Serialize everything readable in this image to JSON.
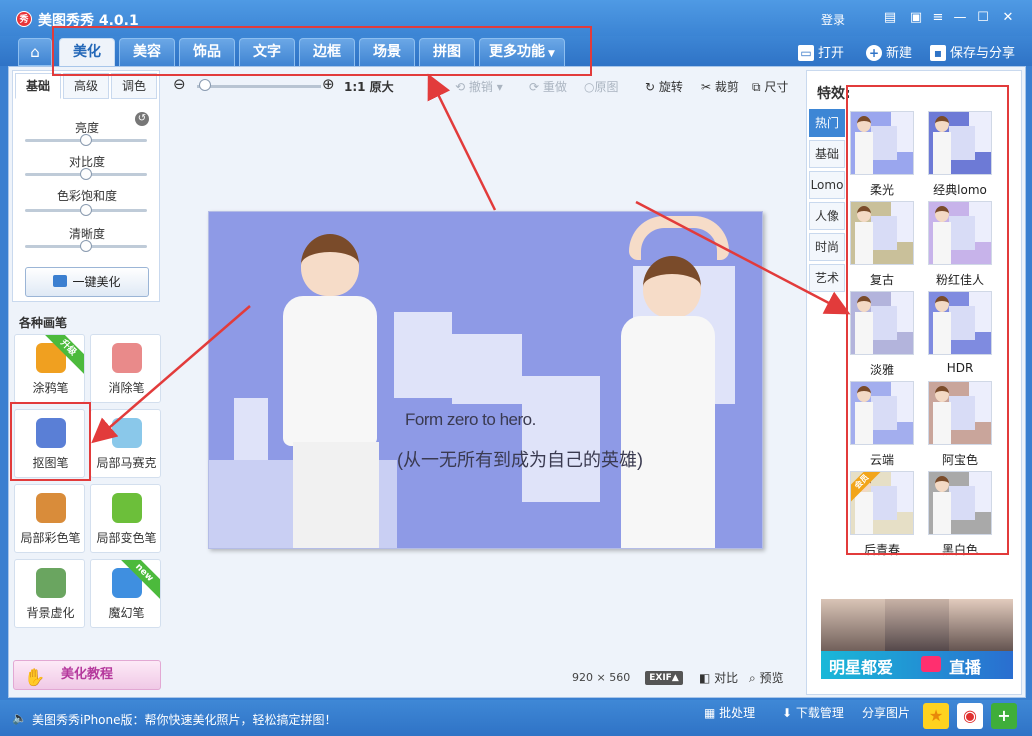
{
  "app": {
    "title": "美图秀秀 4.0.1",
    "logo_text": "秀",
    "login": "登录"
  },
  "title_icons": [
    "chat-icon",
    "feedback-icon",
    "menu-icon",
    "minimize-icon",
    "maximize-icon",
    "close-icon"
  ],
  "tabs": [
    {
      "label": "美化",
      "active": true
    },
    {
      "label": "美容"
    },
    {
      "label": "饰品"
    },
    {
      "label": "文字"
    },
    {
      "label": "边框"
    },
    {
      "label": "场景"
    },
    {
      "label": "拼图"
    },
    {
      "label": "更多功能"
    }
  ],
  "toolbar_actions": {
    "open": "打开",
    "new": "新建",
    "save": "保存与分享"
  },
  "left": {
    "subtabs": [
      "基础",
      "高级",
      "调色"
    ],
    "sliders": [
      {
        "label": "亮度",
        "value": 0.5
      },
      {
        "label": "对比度",
        "value": 0.5
      },
      {
        "label": "色彩饱和度",
        "value": 0.5
      },
      {
        "label": "清晰度",
        "value": 0.5
      }
    ],
    "onekey": "一键美化",
    "brush_heading": "各种画笔",
    "brushes": [
      {
        "label": "涂鸦笔",
        "badge": "升级",
        "color": "#f0a020"
      },
      {
        "label": "消除笔",
        "badge": "",
        "color": "#e98a8a"
      },
      {
        "label": "抠图笔",
        "badge": "",
        "color": "#5a7fd6"
      },
      {
        "label": "局部马赛克",
        "badge": "",
        "color": "#8ac8ea"
      },
      {
        "label": "局部彩色笔",
        "badge": "",
        "color": "#d98c3a"
      },
      {
        "label": "局部变色笔",
        "badge": "",
        "color": "#6cbf3a"
      },
      {
        "label": "背景虚化",
        "badge": "",
        "color": "#6aa560"
      },
      {
        "label": "魔幻笔",
        "badge": "new",
        "color": "#3f8fe0"
      }
    ],
    "tutorial": "美化教程"
  },
  "editbar": {
    "zoom_level": 0,
    "original_size": "1:1 原大",
    "undo": "撤销",
    "redo": "重做",
    "original": "原图",
    "rotate": "旋转",
    "crop": "裁剪",
    "size": "尺寸"
  },
  "photo": {
    "text1": "Form zero to hero.",
    "text2": "(从一无所有到成为自己的英雄)",
    "width": "920",
    "times": "×",
    "height": "560",
    "exif": "EXIF▲",
    "compare": "对比",
    "preview": "预览"
  },
  "effects": {
    "title": "特效:",
    "categories": [
      {
        "label": "热门",
        "active": true
      },
      {
        "label": "基础"
      },
      {
        "label": "Lomo"
      },
      {
        "label": "人像"
      },
      {
        "label": "时尚"
      },
      {
        "label": "艺术"
      }
    ],
    "items": [
      {
        "label": "柔光",
        "tint": "#9aa6ee",
        "badge": ""
      },
      {
        "label": "经典lomo",
        "tint": "#6d7ad6",
        "badge": ""
      },
      {
        "label": "复古",
        "tint": "#c9c09a",
        "badge": ""
      },
      {
        "label": "粉红佳人",
        "tint": "#c7b3ea",
        "badge": ""
      },
      {
        "label": "淡雅",
        "tint": "#b3b4dc",
        "badge": ""
      },
      {
        "label": "HDR",
        "tint": "#7f8be0",
        "badge": ""
      },
      {
        "label": "云端",
        "tint": "#a3aeee",
        "badge": ""
      },
      {
        "label": "阿宝色",
        "tint": "#c9a59b",
        "badge": ""
      },
      {
        "label": "后青春",
        "tint": "#e6dfc6",
        "badge": "会员"
      },
      {
        "label": "黑白色",
        "tint": "#a9a9a9",
        "badge": ""
      }
    ],
    "promo_text1": "明星都爱",
    "promo_text2": "直播"
  },
  "statusbar": {
    "message": "美图秀秀iPhone版：帮你快速美化照片，轻松搞定拼图！",
    "batch": "批处理",
    "download": "下载管理",
    "share": "分享图片"
  },
  "colors": {
    "accent": "#3d86d5",
    "highlight": "#e23b3b",
    "canvas": "#8e9ae6"
  }
}
